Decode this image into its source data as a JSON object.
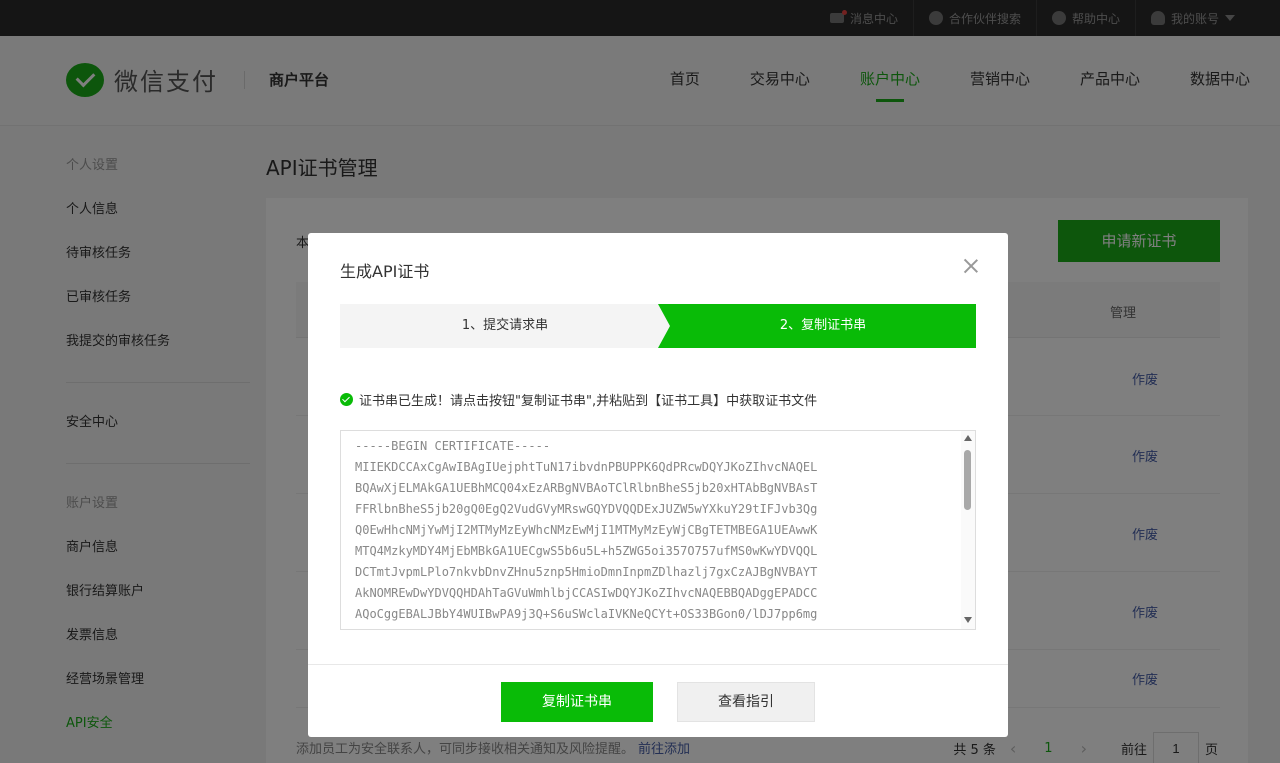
{
  "topbar": {
    "messages": "消息中心",
    "partner_search": "合作伙伴搜索",
    "help": "帮助中心",
    "account": "我的账号"
  },
  "header": {
    "logo_text": "微信支付",
    "platform": "商户平台",
    "nav": [
      "首页",
      "交易中心",
      "账户中心",
      "营销中心",
      "产品中心",
      "数据中心"
    ],
    "active_nav": "账户中心"
  },
  "sidebar": {
    "group1": "个人设置",
    "group1_items": [
      "个人信息",
      "待审核任务",
      "已审核任务",
      "我提交的审核任务"
    ],
    "security_center": "安全中心",
    "group2": "账户设置",
    "group2_items": [
      "商户信息",
      "银行结算账户",
      "发票信息",
      "经营场景管理",
      "API安全"
    ],
    "active_item": "API安全"
  },
  "main": {
    "title": "API证书管理",
    "desc_prefix": "本",
    "apply_button": "申请新证书",
    "col_manage": "管理",
    "rows": [
      {
        "action": "作废"
      },
      {
        "action": "作废"
      },
      {
        "action": "作废"
      },
      {
        "action": "作废"
      },
      {
        "action": "作废"
      }
    ],
    "footer_note": "添加员工为安全联系人，可同步接收相关通知及风险提醒。",
    "footer_link": "前往添加",
    "pager": {
      "total": "共 5 条",
      "current": "1",
      "goto_label": "前往",
      "goto_value": "1",
      "page_suffix": "页"
    }
  },
  "modal": {
    "title": "生成API证书",
    "step1": "1、提交请求串",
    "step2": "2、复制证书串",
    "active_step": 2,
    "notice": "证书串已生成！请点击按钮\"复制证书串\",并粘贴到【证书工具】中获取证书文件",
    "cert_lines": [
      "-----BEGIN CERTIFICATE-----",
      "MIIEKDCCAxCgAwIBAgIUejphtTuN17ibvdnPBUPPK6QdPRcwDQYJKoZIhvcNAQEL",
      "BQAwXjELMAkGA1UEBhMCQ04xEzARBgNVBAoTClRlbnBheS5jb20xHTAbBgNVBAsT",
      "FFRlbnBheS5jb20gQ0EgQ2VudGVyMRswGQYDVQQDExJUZW5wYXkuY29tIFJvb3Qg",
      "Q0EwHhcNMjYwMjI2MTMyMzEyWhcNMzEwMjI1MTMyMzEyWjCBgTETMBEGA1UEAwwK",
      "MTQ4MzkyMDY4MjEbMBkGA1UECgwS5b6u5L+h5ZWG5oi357O757ufMS0wKwYDVQQL",
      "DCTmtJvpmLPlo7nkvbDnvZHnu5znp5HmioDmnInpmZDlhazlj7gxCzAJBgNVBAYT",
      "AkNOMREwDwYDVQQHDAhTaGVuWmhlbjCCASIwDQYJKoZIhvcNAQEBBQADggEPADCC",
      "AQoCggEBALJBbY4WUIBwPA9j3Q+S6uSWclaIVKNeQCYt+OS33BGon0/lDJ7pp6mg"
    ],
    "copy_button": "复制证书串",
    "guide_button": "查看指引"
  }
}
